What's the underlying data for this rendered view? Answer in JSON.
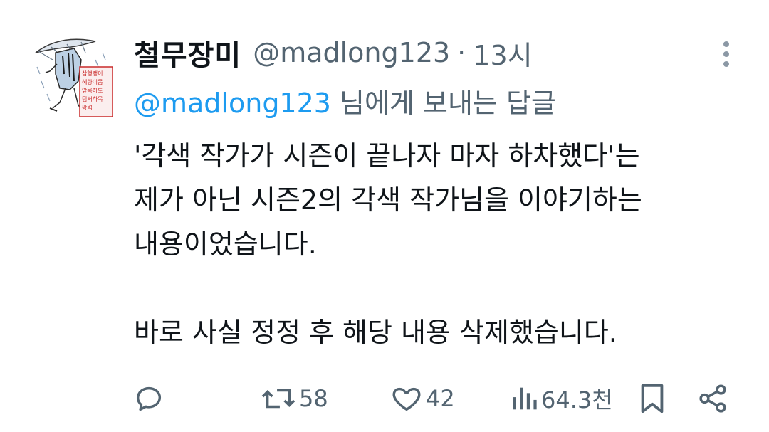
{
  "tweet": {
    "display_name": "철무장미",
    "handle": "@madlong123",
    "separator": "·",
    "time": "13시",
    "reply_to": {
      "handle": "@madlong123",
      "suffix": " 님에게 보내는 답글"
    },
    "body_lines": [
      "'각색 작가가 시즌이 끝나자 마자 하차했다'는",
      "제가 아닌 시즌2의 각색 작가님을 이야기하는",
      "내용이었습니다.",
      "",
      "바로 사실 정정 후 해당 내용 삭제했습니다."
    ],
    "avatar_stamp_text": [
      "삼행랭이",
      "혜향이몸",
      "앞록하도",
      "팀서하목",
      "왕벽"
    ]
  },
  "actions": {
    "reply": {
      "icon": "reply-icon"
    },
    "retweet": {
      "icon": "retweet-icon",
      "count": "58"
    },
    "like": {
      "icon": "heart-icon",
      "count": "42"
    },
    "views": {
      "icon": "views-icon",
      "count": "64.3천"
    },
    "bookmark": {
      "icon": "bookmark-icon"
    },
    "share": {
      "icon": "share-icon"
    }
  },
  "colors": {
    "text": "#0f1419",
    "secondary": "#536471",
    "link": "#1d9bf0",
    "background": "#ffffff"
  }
}
